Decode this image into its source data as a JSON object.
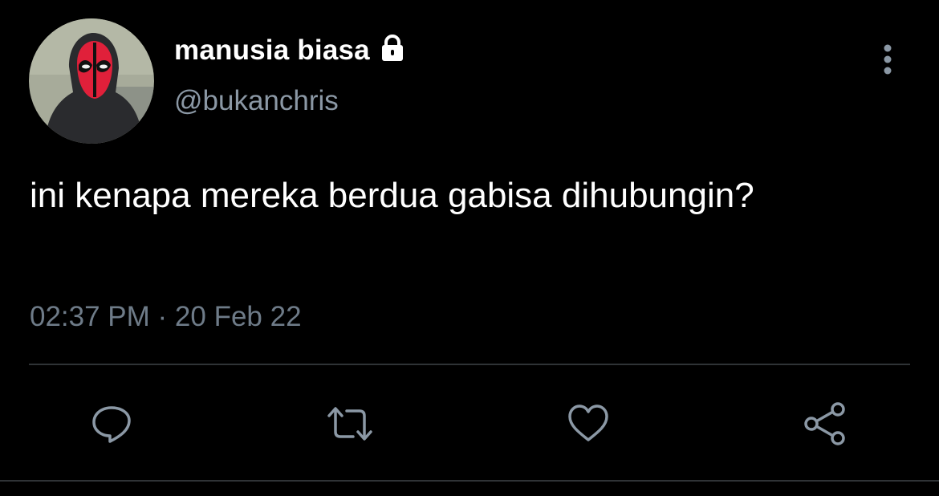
{
  "tweet": {
    "display_name": "manusia biasa",
    "handle": "@bukanchris",
    "text": "ini kenapa mereka berdua gabisa dihubungin?",
    "timestamp": "02:37 PM · 20 Feb 22",
    "avatar_icon": "masked-person-avatar",
    "locked_icon": "lock-icon"
  },
  "actions": [
    {
      "name": "reply",
      "icon": "reply-icon"
    },
    {
      "name": "retweet",
      "icon": "retweet-icon"
    },
    {
      "name": "like",
      "icon": "heart-icon"
    },
    {
      "name": "share",
      "icon": "share-icon"
    }
  ],
  "colors": {
    "background": "#000000",
    "primary_text": "#ffffff",
    "secondary_text": "#8b98a5",
    "timestamp_text": "#6e7b88",
    "icon": "#8b98a5",
    "divider": "#2f3336",
    "mask_red": "#e0203a"
  }
}
